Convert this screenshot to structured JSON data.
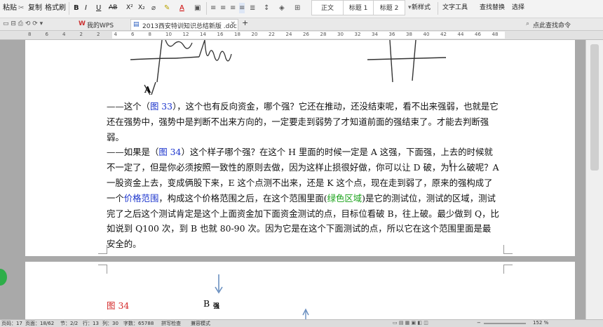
{
  "toolbar": {
    "paste": "粘贴",
    "copy": "复制",
    "format_painter": "格式刷",
    "bold": "B",
    "italic": "I",
    "underline": "U",
    "strike": "AB",
    "superscript": "X²",
    "subscript": "X₂",
    "font_color": "A",
    "style_normal": "正文",
    "style_h1": "标题 1",
    "style_h2": "标题 2",
    "new_style": "新样式",
    "text_tools": "文字工具",
    "find_replace": "查找替换",
    "select": "选择"
  },
  "tabs": {
    "my_wps": "我的WPS",
    "document": "2013西安特训知识总结新版 .doc",
    "add": "+",
    "search_cmd": "点此查找命令"
  },
  "ruler": [
    "8",
    "6",
    "4",
    "2",
    "2",
    "4",
    "6",
    "8",
    "10",
    "12",
    "14",
    "16",
    "18",
    "20",
    "22",
    "24",
    "26",
    "28",
    "30",
    "32",
    "34",
    "36",
    "38",
    "40",
    "42",
    "44",
    "46",
    "48"
  ],
  "document": {
    "label_a": "A",
    "para1_dash": "——这个（",
    "para1_ref": "图 33",
    "para1_rest": "），这个也有反向资金，哪个强？它还在推动，还没结束呢，看不出来强弱，也就是它还在强势中，强势中是判断不出来方向的，一定要走到弱势了才知道前面的强结束了。才能去判断强弱。",
    "para2_dash": "——如果是（",
    "para2_ref": "图 34",
    "para2_a": "）这个样子哪个强？在这个 H 里面的时候一定是 A 这强，下面强，上去的时候就不一定了，但是你必须按照一致性的原则去做，因为这样止损很好做，你可以让 D 破，为什么破呢？A 一股资金上去，变成俩股下来，E 这个点测不出来，还是 K 这个点，现在走到弱了，原来的强构成了一个",
    "para2_price_range": "价格范围",
    "para2_b": "，构成这个价格范围之后，在这个范围里面(",
    "para2_green": "绿色区域",
    "para2_c": ")是它的测试位，测试的区域，测试完了之后这个测试肯定是这个上面资金加下面资金测试的点，目标位看破 B，往上破。最少做到 Q，比如说到 Q100 次，到 B 也就 80-90 次。因为它是在这个下面测试的点，所以它在这个范围里面是最安全的。",
    "fig34_label": "图 34",
    "label_b": "B",
    "label_strong": "强"
  },
  "status": {
    "page": "页码：17",
    "pages": "页面：18/62",
    "section": "节：2/2",
    "row": "行：13",
    "col": "列：30",
    "words": "字数：65788",
    "spell": "拼写检查",
    "mode": "兼容模式",
    "zoom": "152 %"
  },
  "colors": {
    "link": "#1a33cc",
    "green_text": "#1aa21a",
    "fig_red": "#d42a2a"
  }
}
